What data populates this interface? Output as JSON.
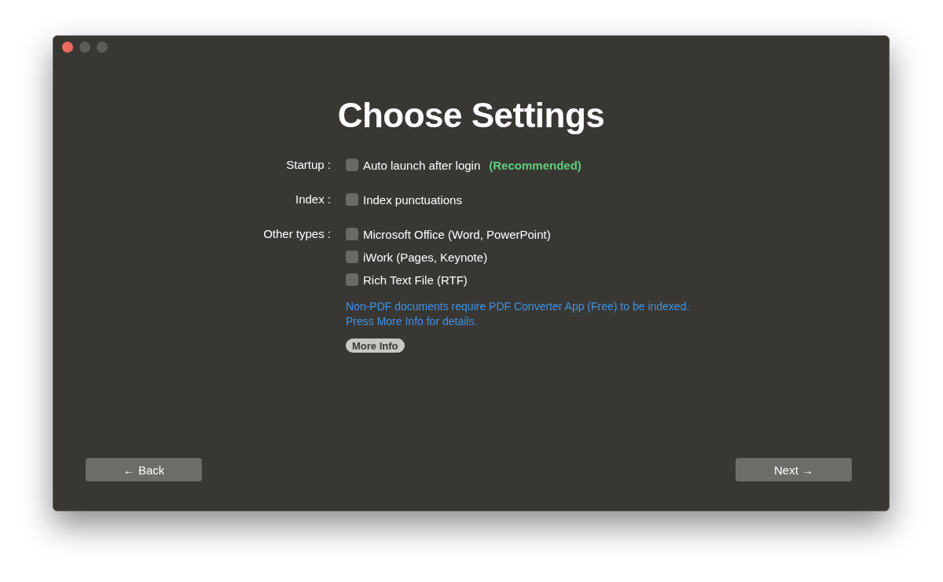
{
  "window": {
    "traffic_lights": [
      {
        "color": "#ed6a5e"
      },
      {
        "color": "#5d5c59"
      },
      {
        "color": "#5d5c59"
      }
    ]
  },
  "title": "Choose Settings",
  "sections": [
    {
      "label": "Startup :",
      "options": [
        {
          "label": "Auto launch after login",
          "checked": false,
          "note": "(Recommended)"
        }
      ]
    },
    {
      "label": "Index :",
      "options": [
        {
          "label": "Index punctuations",
          "checked": false
        }
      ]
    },
    {
      "label": "Other types :",
      "options": [
        {
          "label": "Microsoft Office (Word, PowerPoint)",
          "checked": false
        },
        {
          "label": "iWork (Pages, Keynote)",
          "checked": false
        },
        {
          "label": "Rich Text File (RTF)",
          "checked": false
        }
      ],
      "info": [
        "Non-PDF documents require PDF Converter App (Free) to be indexed.",
        "Press More Info for details."
      ],
      "info_button": "More Info"
    }
  ],
  "buttons": {
    "back": "← Back",
    "next": "Next →"
  }
}
